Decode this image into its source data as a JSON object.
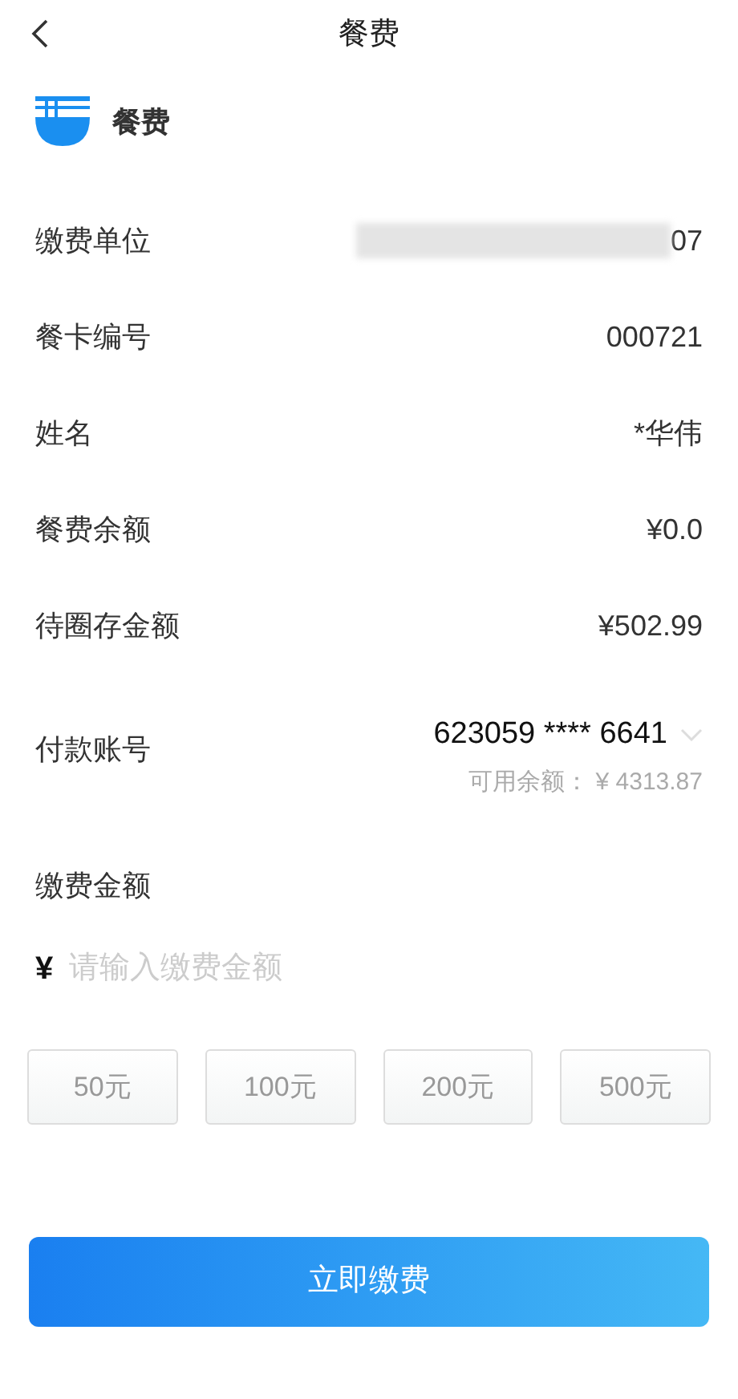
{
  "header": {
    "title": "餐费"
  },
  "service": {
    "name": "餐费"
  },
  "rows": [
    {
      "label": "缴费单位",
      "value": "07",
      "redacted": true
    },
    {
      "label": "餐卡编号",
      "value": "000721",
      "redacted": false
    },
    {
      "label": "姓名",
      "value": "*华伟",
      "redacted": false
    },
    {
      "label": "餐费余额",
      "value": "¥0.0",
      "redacted": false
    },
    {
      "label": "待圈存金额",
      "value": "¥502.99",
      "redacted": false
    }
  ],
  "account": {
    "label": "付款账号",
    "number": "623059 **** 6641",
    "balance": "可用余额： ¥ 4313.87"
  },
  "amount": {
    "label": "缴费金额",
    "currency": "¥",
    "placeholder": "请输入缴费金额"
  },
  "presets": [
    "50元",
    "100元",
    "200元",
    "500元"
  ],
  "submit": "立即缴费"
}
